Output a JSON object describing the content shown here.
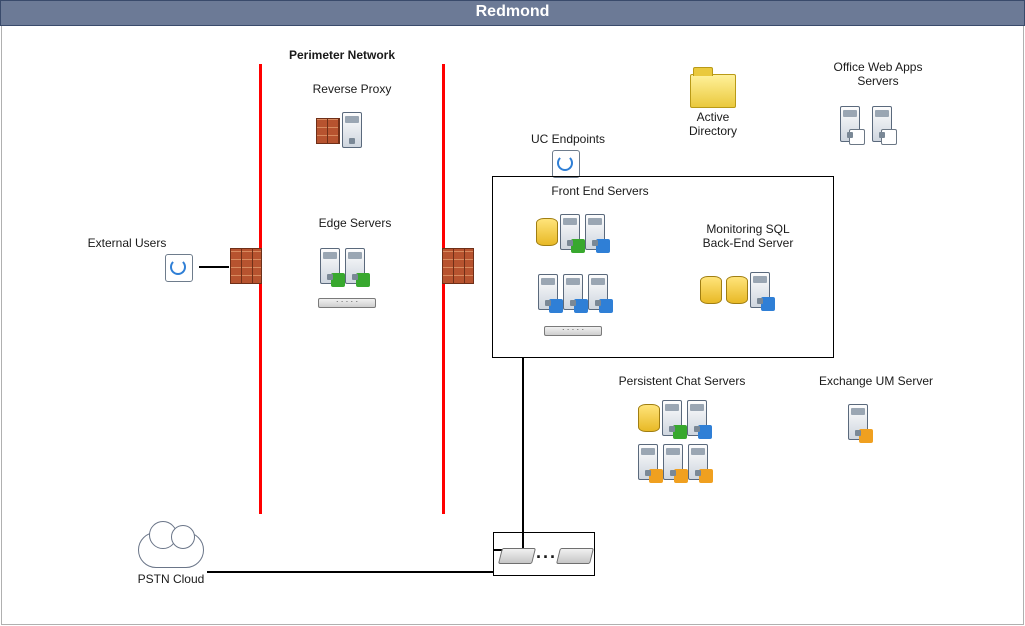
{
  "title": "Redmond",
  "perimeter_heading": "Perimeter Network",
  "labels": {
    "reverse_proxy": "Reverse Proxy",
    "edge_servers": "Edge Servers",
    "external_users": "External Users",
    "uc_endpoints": "UC Endpoints",
    "front_end_servers": "Front End Servers",
    "monitoring_sql": "Monitoring SQL\nBack-End Server",
    "active_directory": "Active\nDirectory",
    "office_web_apps": "Office Web Apps\nServers",
    "persistent_chat": "Persistent Chat Servers",
    "exchange_um": "Exchange UM Server",
    "pstn_cloud": "PSTN Cloud",
    "router_dots": "..."
  }
}
